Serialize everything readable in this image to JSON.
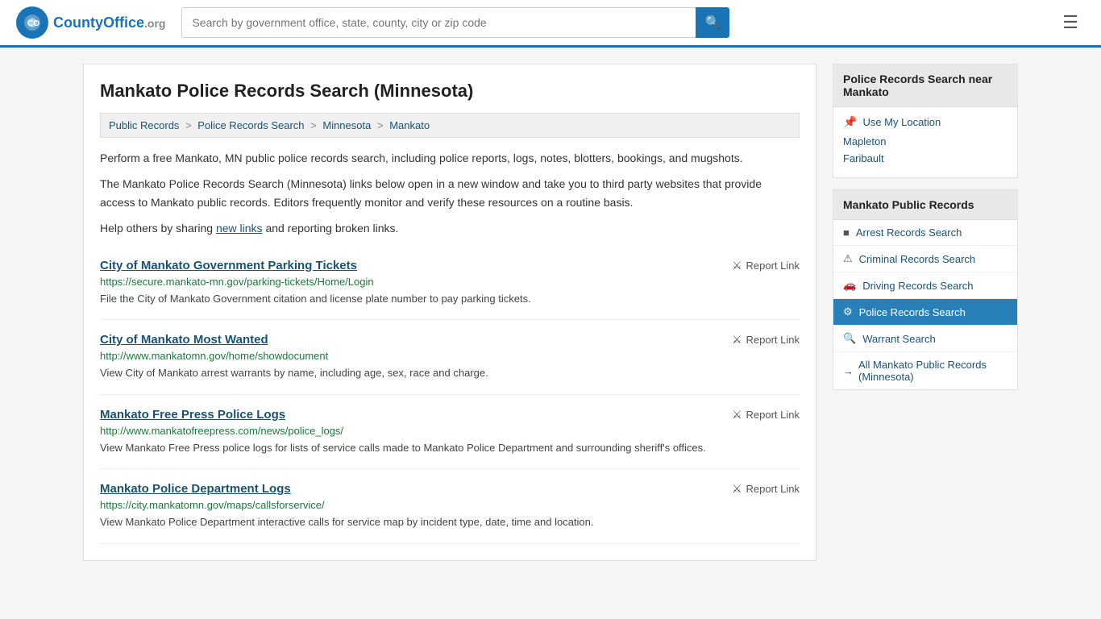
{
  "header": {
    "logo_text": "CountyOffice",
    "logo_org": ".org",
    "search_placeholder": "Search by government office, state, county, city or zip code",
    "search_icon": "🔍"
  },
  "page": {
    "title": "Mankato Police Records Search (Minnesota)",
    "breadcrumb": [
      {
        "label": "Public Records",
        "href": "#"
      },
      {
        "label": "Police Records Search",
        "href": "#"
      },
      {
        "label": "Minnesota",
        "href": "#"
      },
      {
        "label": "Mankato",
        "href": "#"
      }
    ],
    "intro1": "Perform a free Mankato, MN public police records search, including police reports, logs, notes, blotters, bookings, and mugshots.",
    "intro2": "The Mankato Police Records Search (Minnesota) links below open in a new window and take you to third party websites that provide access to Mankato public records. Editors frequently monitor and verify these resources on a routine basis.",
    "intro3_before": "Help others by sharing ",
    "intro3_link": "new links",
    "intro3_after": " and reporting broken links."
  },
  "results": [
    {
      "title": "City of Mankato Government Parking Tickets",
      "url": "https://secure.mankato-mn.gov/parking-tickets/Home/Login",
      "desc": "File the City of Mankato Government citation and license plate number to pay parking tickets.",
      "report_label": "Report Link"
    },
    {
      "title": "City of Mankato Most Wanted",
      "url": "http://www.mankatomn.gov/home/showdocument",
      "desc": "View City of Mankato arrest warrants by name, including age, sex, race and charge.",
      "report_label": "Report Link"
    },
    {
      "title": "Mankato Free Press Police Logs",
      "url": "http://www.mankatofreepress.com/news/police_logs/",
      "desc": "View Mankato Free Press police logs for lists of service calls made to Mankato Police Department and surrounding sheriff's offices.",
      "report_label": "Report Link"
    },
    {
      "title": "Mankato Police Department Logs",
      "url": "https://city.mankatomn.gov/maps/callsforservice/",
      "desc": "View Mankato Police Department interactive calls for service map by incident type, date, time and location.",
      "report_label": "Report Link"
    }
  ],
  "sidebar": {
    "nearby_title": "Police Records Search near Mankato",
    "use_location": "Use My Location",
    "nearby_links": [
      {
        "label": "Mapleton",
        "href": "#"
      },
      {
        "label": "Faribault",
        "href": "#"
      }
    ],
    "public_records_title": "Mankato Public Records",
    "menu_items": [
      {
        "label": "Arrest Records Search",
        "icon": "■",
        "active": false
      },
      {
        "label": "Criminal Records Search",
        "icon": "!",
        "active": false
      },
      {
        "label": "Driving Records Search",
        "icon": "🚗",
        "active": false
      },
      {
        "label": "Police Records Search",
        "icon": "⚙",
        "active": true
      },
      {
        "label": "Warrant Search",
        "icon": "🔍",
        "active": false
      }
    ],
    "all_records_label": "All Mankato Public Records (Minnesota)"
  }
}
